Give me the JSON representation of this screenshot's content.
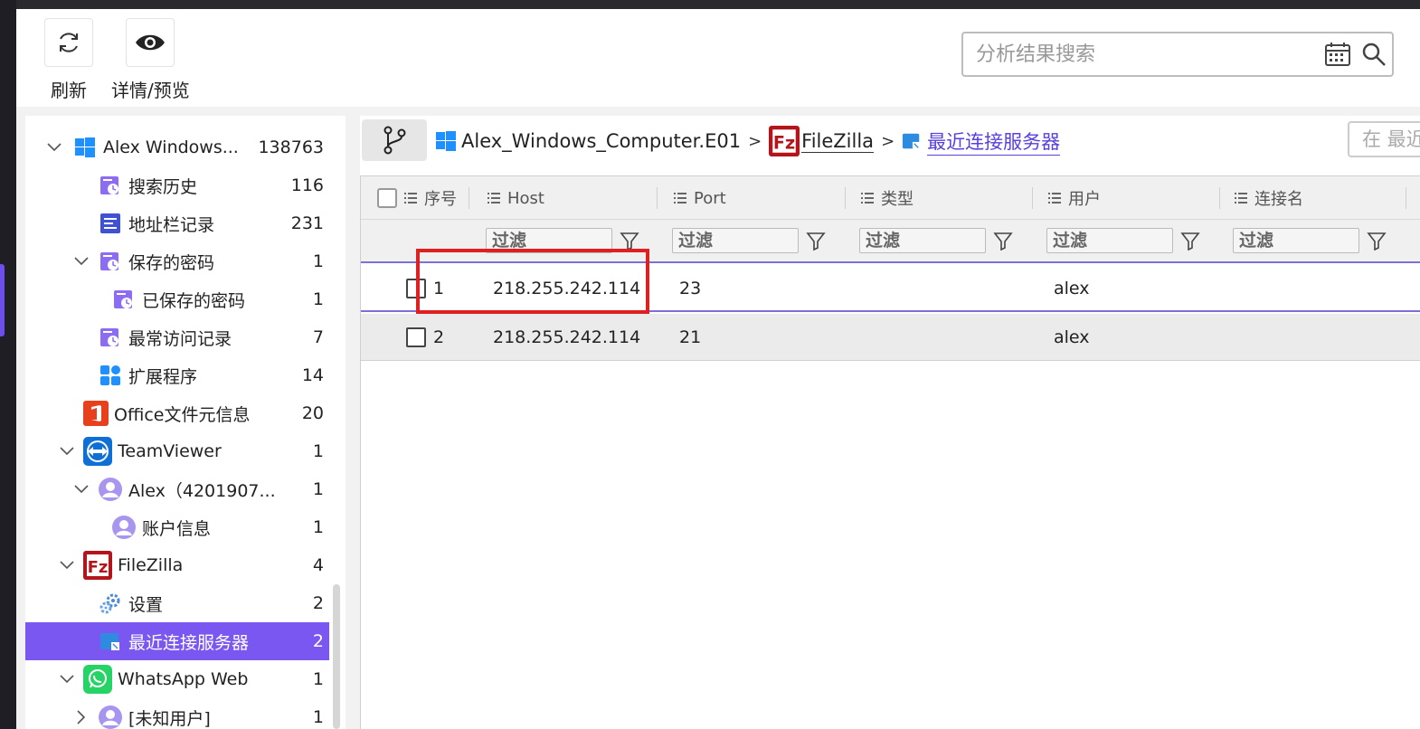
{
  "toolbar": {
    "refresh_label": "刷新",
    "details_label": "详情/预览",
    "search_placeholder": "分析结果搜索"
  },
  "sidebar": {
    "items": [
      {
        "label": "Alex Windows...",
        "count": "138763",
        "icon": "windows-icon"
      },
      {
        "label": "搜索历史",
        "count": "116",
        "icon": "history-icon"
      },
      {
        "label": "地址栏记录",
        "count": "231",
        "icon": "address-bar-icon"
      },
      {
        "label": "保存的密码",
        "count": "1",
        "icon": "history-icon"
      },
      {
        "label": "已保存的密码",
        "count": "1",
        "icon": "history-icon"
      },
      {
        "label": "最常访问记录",
        "count": "7",
        "icon": "history-icon"
      },
      {
        "label": "扩展程序",
        "count": "14",
        "icon": "extension-icon"
      },
      {
        "label": "Office文件元信息",
        "count": "20",
        "icon": "office-icon"
      },
      {
        "label": "TeamViewer",
        "count": "1",
        "icon": "teamviewer-icon"
      },
      {
        "label": "Alex（4201907...",
        "count": "1",
        "icon": "user-icon"
      },
      {
        "label": "账户信息",
        "count": "1",
        "icon": "user-icon"
      },
      {
        "label": "FileZilla",
        "count": "4",
        "icon": "filezilla-icon"
      },
      {
        "label": "设置",
        "count": "2",
        "icon": "settings-icon"
      },
      {
        "label": "最近连接服务器",
        "count": "2",
        "icon": "server-icon"
      },
      {
        "label": "WhatsApp Web",
        "count": "1",
        "icon": "whatsapp-icon"
      },
      {
        "label": "[未知用户]",
        "count": "1",
        "icon": "user-icon"
      }
    ]
  },
  "breadcrumb": {
    "root": "Alex_Windows_Computer.E01",
    "app": "FileZilla",
    "current": "最近连接服务器"
  },
  "right_search_text": "在 最近",
  "table": {
    "columns": [
      "序号",
      "Host",
      "Port",
      "类型",
      "用户",
      "连接名"
    ],
    "filter_placeholder": "过滤",
    "rows": [
      {
        "index": "1",
        "host": "218.255.242.114",
        "port": "23",
        "type": "",
        "user": "alex",
        "name": ""
      },
      {
        "index": "2",
        "host": "218.255.242.114",
        "port": "21",
        "type": "",
        "user": "alex",
        "name": ""
      }
    ]
  },
  "colors": {
    "accent": "#7b57f2",
    "highlight_box": "#e02020",
    "link": "#5a3fe0"
  }
}
